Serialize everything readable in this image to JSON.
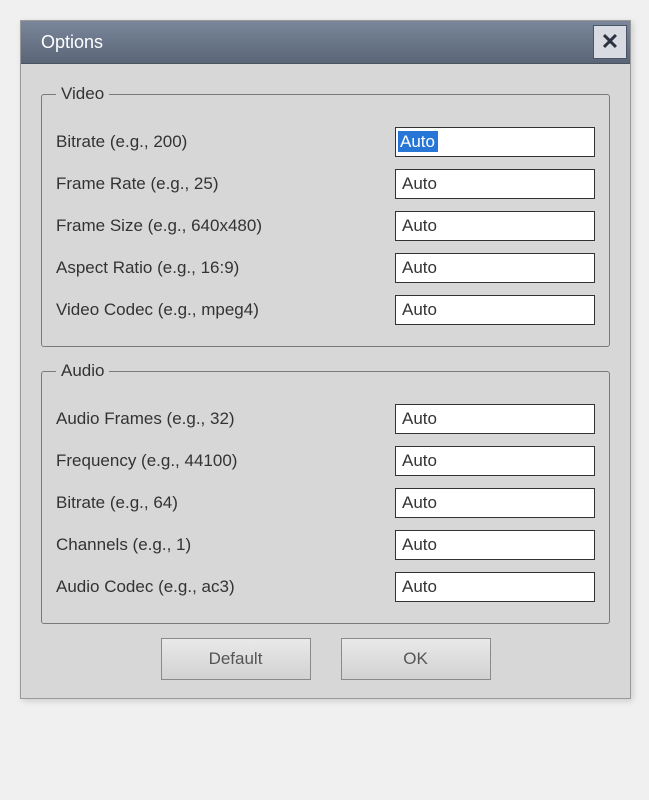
{
  "title": "Options",
  "close_glyph": "✕",
  "groups": {
    "video": {
      "legend": "Video",
      "fields": {
        "bitrate": {
          "label": "Bitrate (e.g., 200)",
          "value": "Auto",
          "selected": true
        },
        "frame_rate": {
          "label": "Frame Rate (e.g., 25)",
          "value": "Auto"
        },
        "frame_size": {
          "label": "Frame Size (e.g., 640x480)",
          "value": "Auto"
        },
        "aspect": {
          "label": "Aspect Ratio (e.g., 16:9)",
          "value": "Auto"
        },
        "codec": {
          "label": "Video Codec (e.g., mpeg4)",
          "value": "Auto"
        }
      }
    },
    "audio": {
      "legend": "Audio",
      "fields": {
        "frames": {
          "label": "Audio Frames (e.g., 32)",
          "value": "Auto"
        },
        "freq": {
          "label": "Frequency (e.g., 44100)",
          "value": "Auto"
        },
        "bitrate": {
          "label": "Bitrate (e.g., 64)",
          "value": "Auto"
        },
        "channels": {
          "label": "Channels (e.g., 1)",
          "value": "Auto"
        },
        "codec": {
          "label": "Audio Codec (e.g., ac3)",
          "value": "Auto"
        }
      }
    }
  },
  "buttons": {
    "default": "Default",
    "ok": "OK"
  }
}
